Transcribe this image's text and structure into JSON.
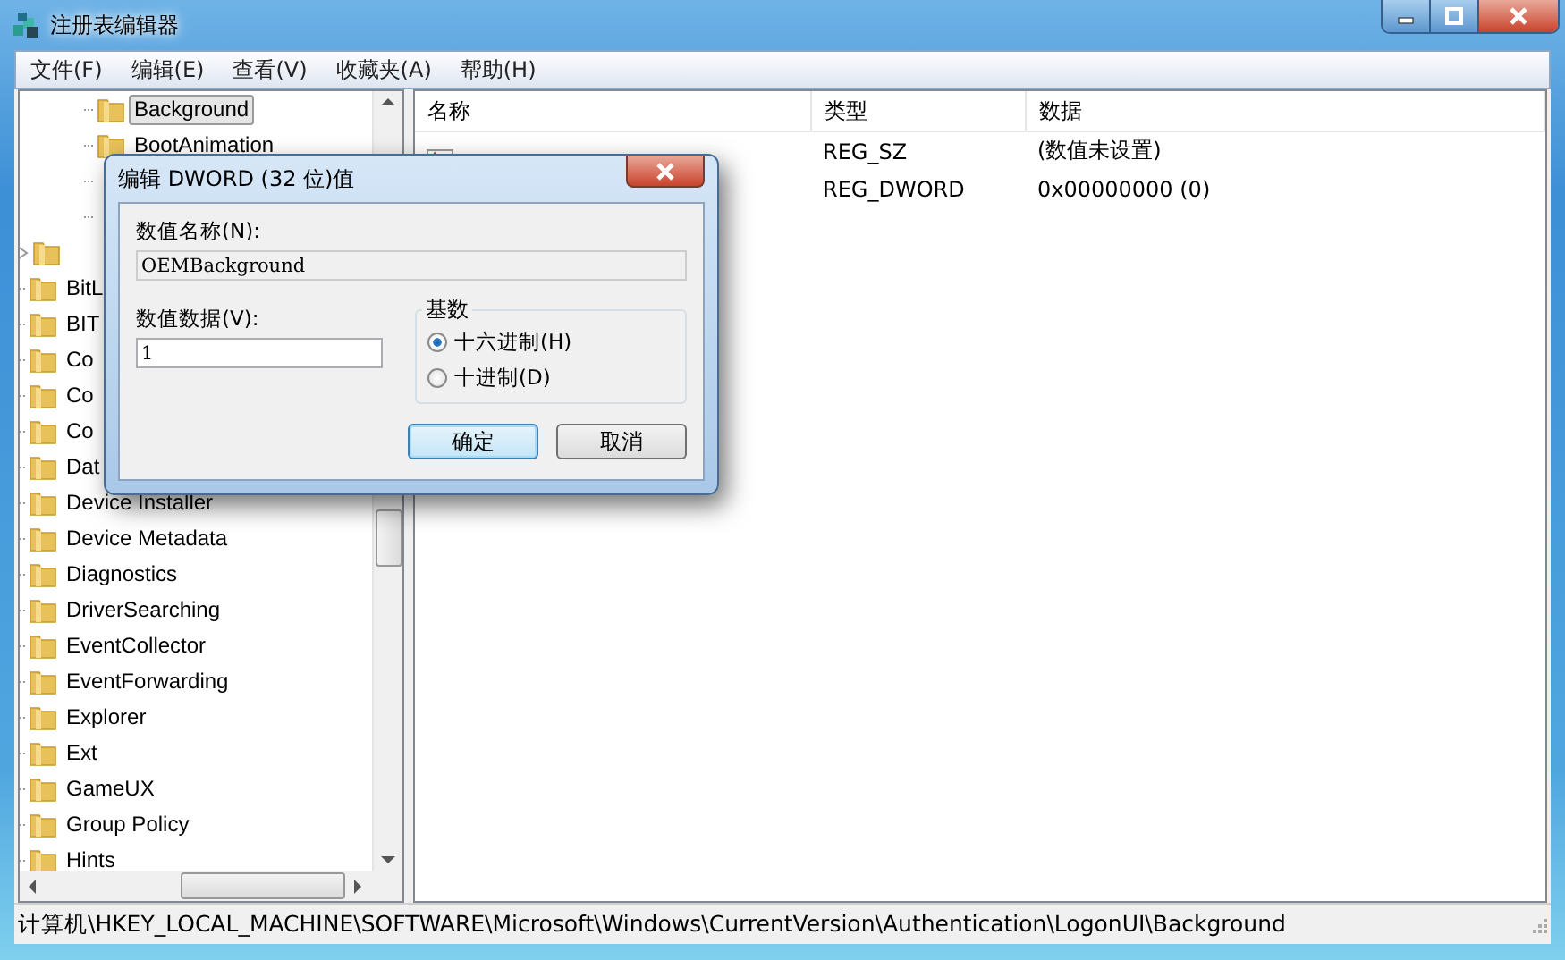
{
  "window": {
    "title": "注册表编辑器"
  },
  "menu": [
    {
      "label": "文件(F)"
    },
    {
      "label": "编辑(E)"
    },
    {
      "label": "查看(V)"
    },
    {
      "label": "收藏夹(A)"
    },
    {
      "label": "帮助(H)"
    }
  ],
  "tree": {
    "items": [
      {
        "children": [
          {
            "kind": "folder",
            "label": "Background",
            "selected": true
          },
          {
            "kind": "folder",
            "label": "BootAnimation",
            "selected": false
          },
          {
            "kind": "connector"
          },
          {
            "kind": "connector"
          }
        ]
      },
      {
        "kind": "folder",
        "expanded": false
      },
      {
        "kind": "folder",
        "label": "BitL",
        "selected": false
      },
      {
        "kind": "folder",
        "label": "BIT",
        "selected": false
      },
      {
        "kind": "folder",
        "label": "Co",
        "selected": false
      },
      {
        "kind": "folder",
        "label": "Co",
        "selected": false
      },
      {
        "kind": "folder",
        "label": "Co",
        "selected": false
      },
      {
        "kind": "folder",
        "label": "Dat",
        "selected": false
      },
      {
        "kind": "folder",
        "label": "Device Installer",
        "selected": false
      },
      {
        "kind": "folder",
        "label": "Device Metadata",
        "selected": false
      },
      {
        "kind": "folder",
        "label": "Diagnostics",
        "selected": false
      },
      {
        "kind": "folder",
        "label": "DriverSearching",
        "selected": false
      },
      {
        "kind": "folder",
        "label": "EventCollector",
        "selected": false
      },
      {
        "kind": "folder",
        "label": "EventForwarding",
        "selected": false
      },
      {
        "kind": "folder",
        "label": "Explorer",
        "selected": false
      },
      {
        "kind": "folder",
        "label": "Ext",
        "selected": false
      },
      {
        "kind": "folder",
        "label": "GameUX",
        "selected": false
      },
      {
        "kind": "folder",
        "label": "Group Policy",
        "selected": false
      },
      {
        "kind": "folder",
        "label": "Hints",
        "selected": false
      }
    ]
  },
  "list": {
    "columns": [
      "名称",
      "类型",
      "数据"
    ],
    "rows": [
      {
        "kind": "string",
        "type": "REG_SZ",
        "data": "(数值未设置)"
      },
      {
        "kind": "binary",
        "type": "REG_DWORD",
        "data": "0x00000000 (0)"
      }
    ]
  },
  "status_bar": "计算机\\HKEY_LOCAL_MACHINE\\SOFTWARE\\Microsoft\\Windows\\CurrentVersion\\Authentication\\LogonUI\\Background",
  "dialog": {
    "title": "编辑 DWORD (32 位)值",
    "name_label": "数值名称(N):",
    "name_value": "OEMBackground",
    "data_label": "数值数据(V):",
    "data_value": "1",
    "base": {
      "title": "基数",
      "options": [
        {
          "label": "十六进制(H)",
          "selected": true
        },
        {
          "label": "十进制(D)",
          "selected": false
        }
      ]
    },
    "buttons": [
      {
        "label": "确定",
        "default": true
      },
      {
        "label": "取消",
        "default": false
      }
    ]
  }
}
